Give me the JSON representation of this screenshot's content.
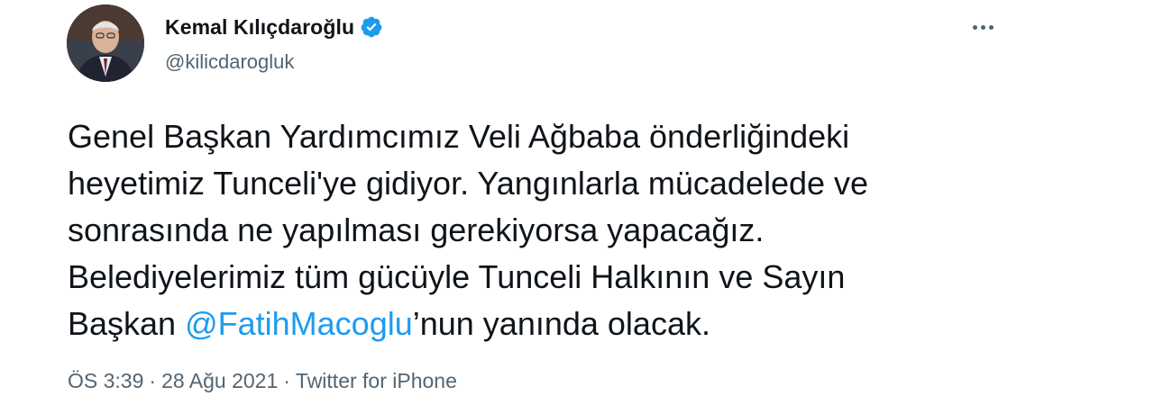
{
  "user": {
    "display_name": "Kemal Kılıçdaroğlu",
    "handle": "@kilicdarogluk"
  },
  "more_icon": "more-horizontal-icon",
  "verified_icon": "verified-badge-icon",
  "tweet": {
    "line1": "Genel Başkan Yardımcımız Veli Ağbaba önderliğindeki",
    "line2": "heyetimiz Tunceli'ye gidiyor. Yangınlarla mücadelede ve",
    "line3": "sonrasında ne yapılması gerekiyorsa yapacağız.",
    "line4": "Belediyelerimiz tüm gücüyle Tunceli Halkının ve Sayın",
    "line5_prefix": "Başkan ",
    "line5_mention": "@FatihMacoglu",
    "line5_suffix": "’nun yanında olacak."
  },
  "meta": {
    "time": "ÖS 3:39",
    "separator": "·",
    "date": "28 Ağu 2021",
    "source": "Twitter for iPhone"
  },
  "colors": {
    "accent": "#1d9bf0",
    "text": "#0f1419",
    "secondary": "#536471"
  }
}
